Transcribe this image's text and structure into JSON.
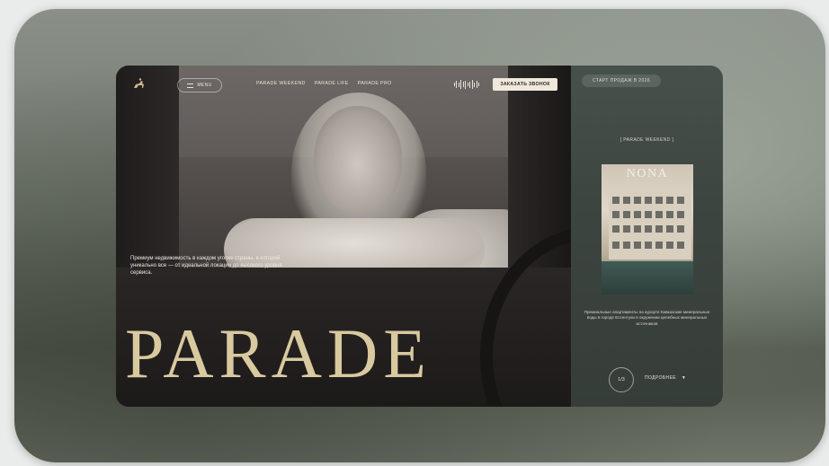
{
  "nav": {
    "menu_label": "MENU",
    "links": [
      "PARADE WEEKEND",
      "PARADE LIFE",
      "PARADE PRO"
    ],
    "cta_label": "ЗАКАЗАТЬ ЗВОНОК"
  },
  "hero": {
    "description": "Премиум недвижимость в каждом уголке страны, в которой уникально все — от идеальной локации до высокого уровня сервиса.",
    "brand": "PARADE"
  },
  "side": {
    "sale_badge": "СТАРТ ПРОДАЖ В 2026",
    "project_tag": "[ PARADE WEEKEND ]",
    "project_name": "NONA",
    "project_description": "Премиальные апартаменты на курорте Кавказские минеральные воды в городе Ессентуки в окружении целебных минеральных источников",
    "counter": "1/3",
    "more_label": "ПОДРОБНЕЕ"
  },
  "colors": {
    "accent_gold": "#d9c99f",
    "cta_background": "#efe8db",
    "side_panel": "#3d4540"
  },
  "icons": {
    "logo": "horse-rider-icon",
    "menu": "hamburger-icon",
    "sound": "sound-wave-icon",
    "more": "chevron-down-icon"
  }
}
